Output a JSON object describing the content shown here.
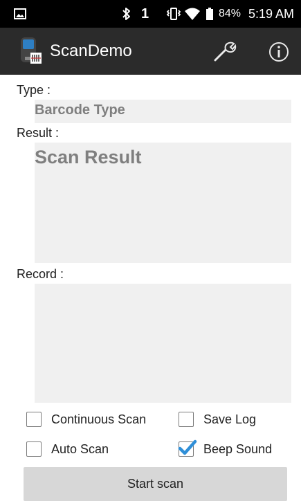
{
  "status_bar": {
    "image_icon": "image-icon",
    "bluetooth_icon": "bluetooth-icon",
    "sim_indicator": "1",
    "vibrate_icon": "vibrate-icon",
    "wifi_icon": "wifi-icon",
    "battery_icon": "battery-icon",
    "battery_percent": "84%",
    "time": "5:19 AM"
  },
  "app_bar": {
    "app_icon": "scanner-device-icon",
    "title": "ScanDemo",
    "settings_icon": "wrench-icon",
    "info_icon": "info-icon"
  },
  "type_section": {
    "label": "Type :",
    "value": "Barcode Type"
  },
  "result_section": {
    "label": "Result :",
    "value": "Scan Result"
  },
  "record_section": {
    "label": "Record :",
    "value": ""
  },
  "options": {
    "continuous_scan": {
      "label": "Continuous Scan",
      "checked": false
    },
    "save_log": {
      "label": "Save Log",
      "checked": false
    },
    "auto_scan": {
      "label": "Auto Scan",
      "checked": false
    },
    "beep_sound": {
      "label": "Beep Sound",
      "checked": true
    }
  },
  "start_button": {
    "label": "Start scan"
  },
  "colors": {
    "status_bar_bg": "#000000",
    "app_bar_bg": "#2b2b2b",
    "field_bg": "#f0f0f0",
    "field_text": "#7f7f7f",
    "checkbox_accent": "#2f8fd8",
    "button_bg": "#d7d7d7"
  }
}
